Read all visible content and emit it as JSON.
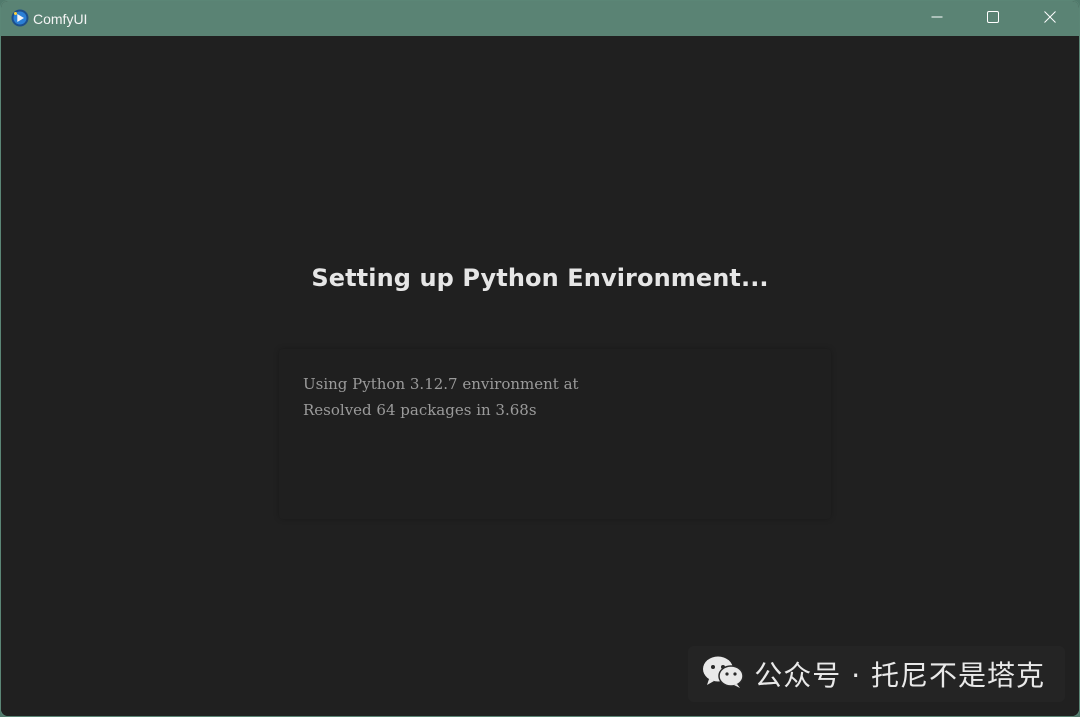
{
  "window": {
    "title": "ComfyUI",
    "app_icon": "comfyui-logo-icon",
    "controls": {
      "minimize_icon": "minimize-icon",
      "maximize_icon": "maximize-icon",
      "close_icon": "close-icon"
    }
  },
  "main": {
    "heading": "Setting up Python Environment...",
    "log_lines": [
      "Using Python 3.12.7 environment at",
      "Resolved 64 packages in 3.68s"
    ]
  },
  "watermark": {
    "icon": "wechat-icon",
    "text": "公众号 · 托尼不是塔克"
  },
  "colors": {
    "titlebar": "#5a8374",
    "background": "#202020",
    "heading": "#e6e6e6",
    "log_text": "#9a9a9a"
  }
}
